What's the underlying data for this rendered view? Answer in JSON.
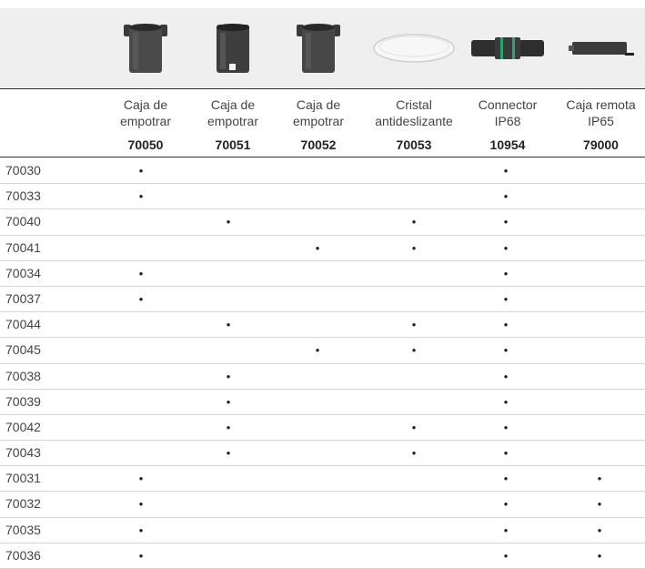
{
  "columns": [
    {
      "name": "Caja de empotrar",
      "code": "70050",
      "icon": "recessed-box-cylinder-icon"
    },
    {
      "name": "Caja de empotrar",
      "code": "70051",
      "icon": "recessed-box-cylinder-icon"
    },
    {
      "name": "Caja de empotrar",
      "code": "70052",
      "icon": "recessed-box-cylinder-icon"
    },
    {
      "name": "Cristal antideslizante",
      "code": "70053",
      "icon": "glass-disc-icon"
    },
    {
      "name": "Connector IP68",
      "code": "10954",
      "icon": "connector-icon"
    },
    {
      "name": "Caja remota IP65",
      "code": "79000",
      "icon": "remote-box-icon"
    }
  ],
  "bullet": "•",
  "rows": [
    {
      "code": "70030",
      "marks": [
        1,
        0,
        0,
        0,
        1,
        0
      ]
    },
    {
      "code": "70033",
      "marks": [
        1,
        0,
        0,
        0,
        1,
        0
      ]
    },
    {
      "code": "70040",
      "marks": [
        0,
        1,
        0,
        1,
        1,
        0
      ]
    },
    {
      "code": "70041",
      "marks": [
        0,
        0,
        1,
        1,
        1,
        0
      ]
    },
    {
      "code": "70034",
      "marks": [
        1,
        0,
        0,
        0,
        1,
        0
      ]
    },
    {
      "code": "70037",
      "marks": [
        1,
        0,
        0,
        0,
        1,
        0
      ]
    },
    {
      "code": "70044",
      "marks": [
        0,
        1,
        0,
        1,
        1,
        0
      ]
    },
    {
      "code": "70045",
      "marks": [
        0,
        0,
        1,
        1,
        1,
        0
      ]
    },
    {
      "code": "70038",
      "marks": [
        0,
        1,
        0,
        0,
        1,
        0
      ]
    },
    {
      "code": "70039",
      "marks": [
        0,
        1,
        0,
        0,
        1,
        0
      ]
    },
    {
      "code": "70042",
      "marks": [
        0,
        1,
        0,
        1,
        1,
        0
      ]
    },
    {
      "code": "70043",
      "marks": [
        0,
        1,
        0,
        1,
        1,
        0
      ]
    },
    {
      "code": "70031",
      "marks": [
        1,
        0,
        0,
        0,
        1,
        1
      ]
    },
    {
      "code": "70032",
      "marks": [
        1,
        0,
        0,
        0,
        1,
        1
      ]
    },
    {
      "code": "70035",
      "marks": [
        1,
        0,
        0,
        0,
        1,
        1
      ]
    },
    {
      "code": "70036",
      "marks": [
        1,
        0,
        0,
        0,
        1,
        1
      ]
    }
  ]
}
